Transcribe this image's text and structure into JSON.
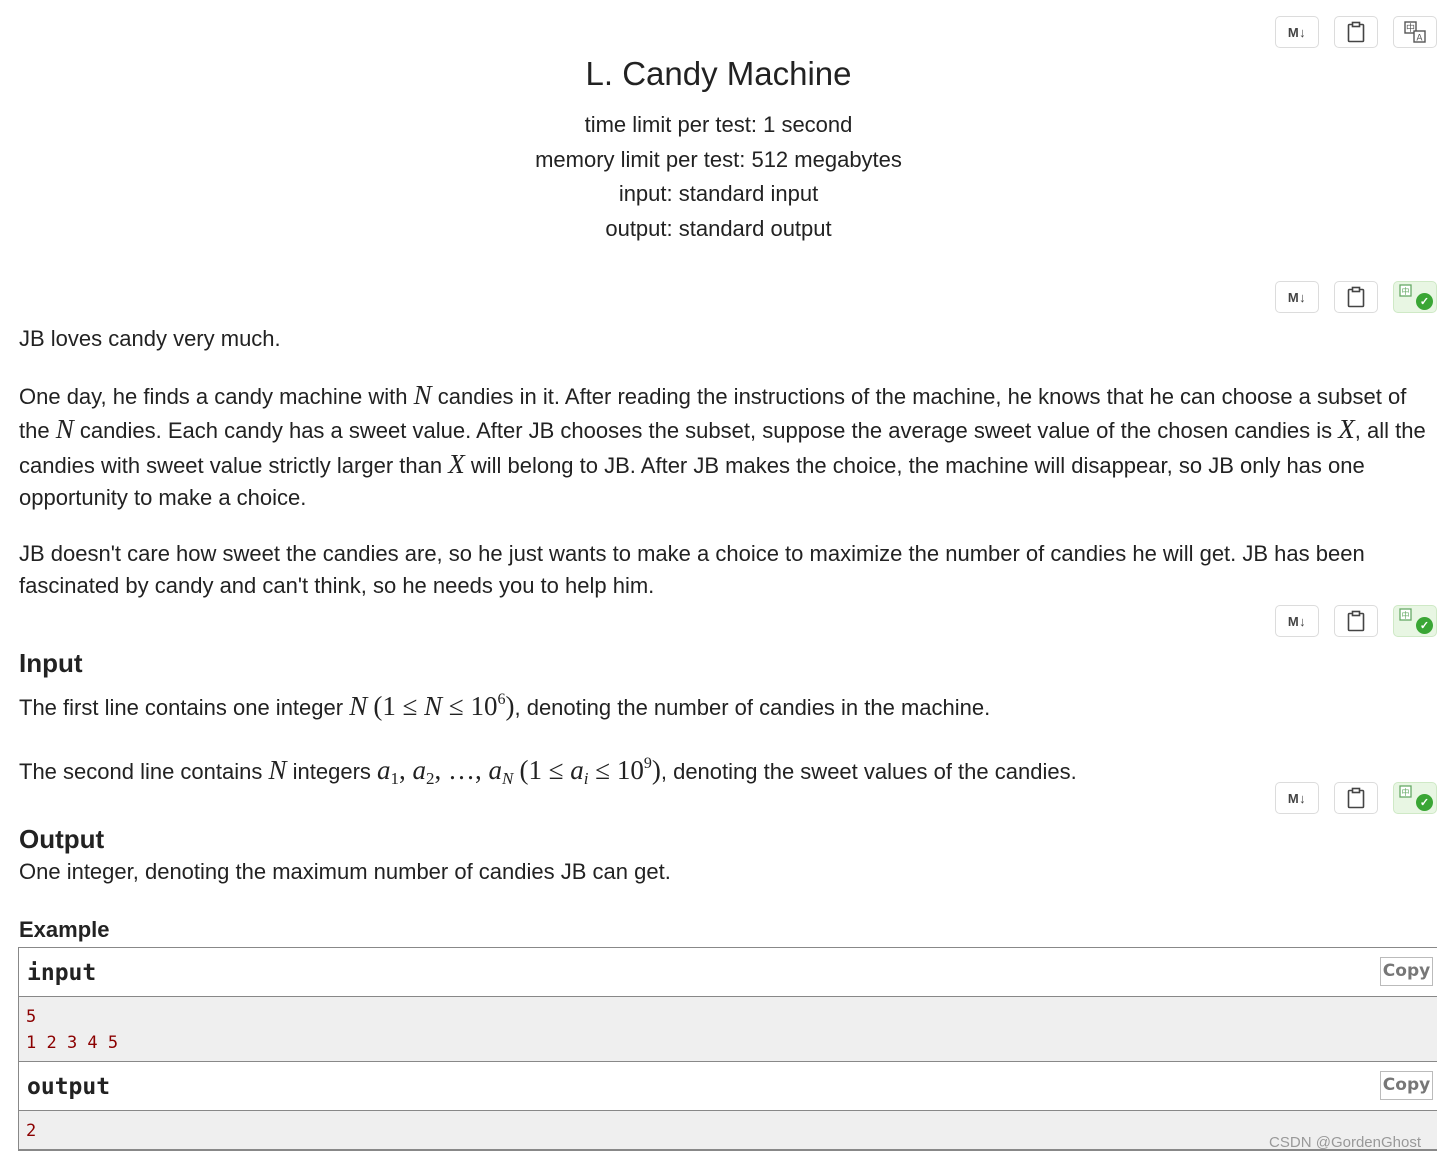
{
  "toolbar": {
    "markdown_icon": "M↓",
    "copy_icon": "clipboard-icon",
    "translate_icon": "translate-icon",
    "check_glyph": "✓"
  },
  "header": {
    "title": "L. Candy Machine",
    "time_limit": "time limit per test: 1 second",
    "memory_limit": "memory limit per test: 512 megabytes",
    "input": "input: standard input",
    "output": "output: standard output"
  },
  "legend": {
    "p1": "JB loves candy very much.",
    "p2": {
      "t1": "One day, he finds a candy machine with ",
      "m1": "N",
      "t2": " candies in it. After reading the instructions of the machine, he knows that he can choose a subset of the ",
      "m2": "N",
      "t3": " candies. Each candy has a sweet value. After JB chooses the subset, suppose the average sweet value of the chosen candies is ",
      "m3": "X",
      "t4": ", all the candies with sweet value strictly larger than ",
      "m4": "X",
      "t5": " will belong to JB. After JB makes the choice, the machine will disappear, so JB only has one opportunity to make a choice."
    },
    "p3": "JB doesn't care how sweet the candies are, so he just wants to make a choice to maximize the number of candies he will get. JB has been fascinated by candy and can't think, so he needs you to help him."
  },
  "input_section": {
    "title": "Input",
    "line1": {
      "t1": "The first line contains one integer ",
      "m1": "N",
      "m2a": "(1 ≤ ",
      "m2b": "N",
      "m2c": " ≤ 10",
      "sup": "6",
      "m2d": ")",
      "t2": ", denoting the number of candies in the machine."
    },
    "line2": {
      "t1": "The second line contains ",
      "m1": "N",
      "t2": " integers ",
      "a": "a",
      "s1": "1",
      "s2": "2",
      "sN": "N",
      "dots": ", …, ",
      "comma": ", ",
      "r1": "(1 ≤ ",
      "ai": "a",
      "si": "i",
      "r2": " ≤ 10",
      "sup": "9",
      "r3": ")",
      "t3": ", denoting the sweet values of the candies."
    }
  },
  "output_section": {
    "title": "Output",
    "text": "One integer, denoting the maximum number of candies JB can get."
  },
  "example": {
    "title": "Example",
    "input_label": "input",
    "output_label": "output",
    "copy_label": "Copy",
    "input_text": "5\n1 2 3 4 5",
    "output_text": "2"
  },
  "watermark": "CSDN @GordenGhost",
  "colors": {
    "sample_text": "#8b0000",
    "sample_bg": "#efefef",
    "translated_bg": "#e8f6e3",
    "check_green": "#3aa635"
  }
}
